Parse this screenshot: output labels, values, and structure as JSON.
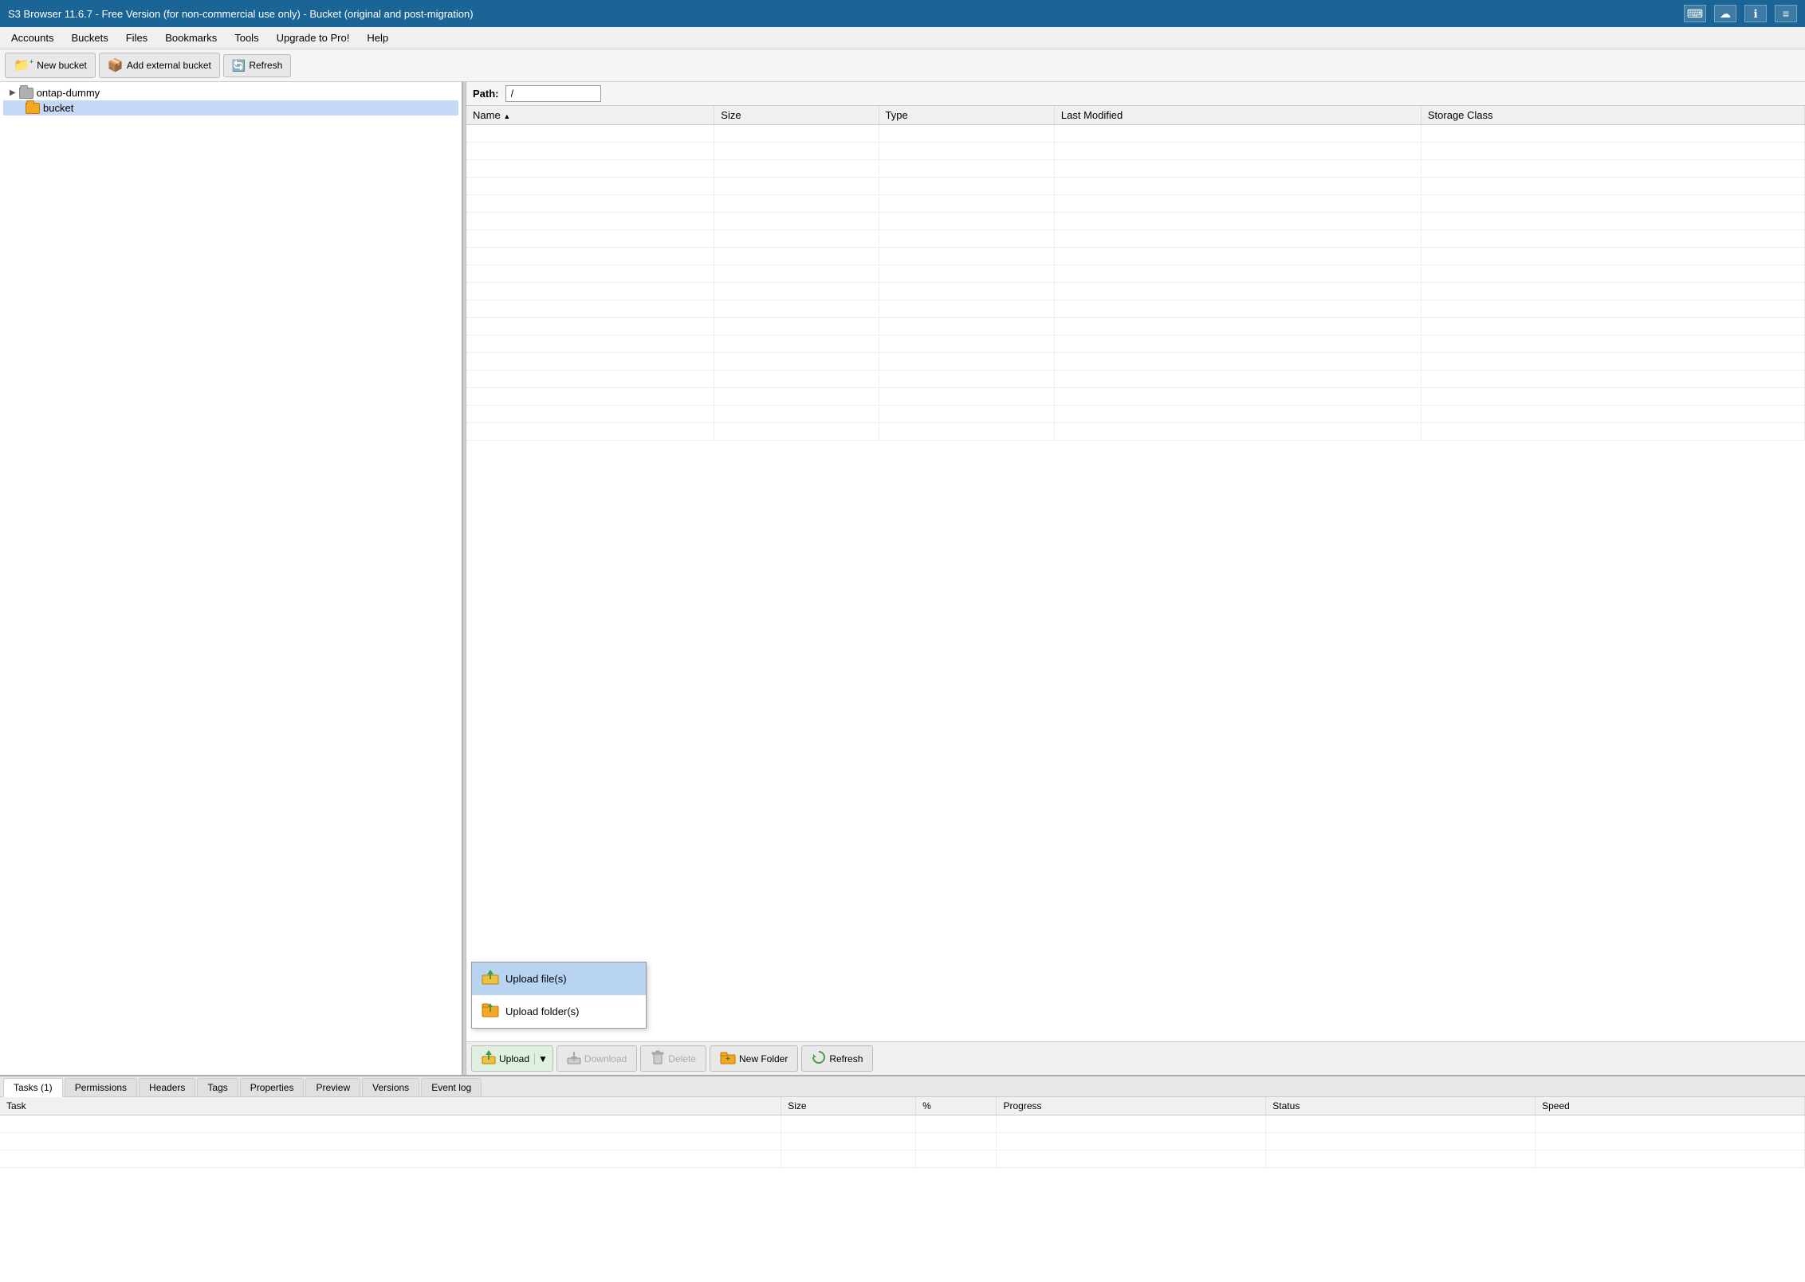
{
  "titleBar": {
    "title": "S3 Browser 11.6.7 - Free Version (for non-commercial use only) - Bucket (original and post-migration)",
    "icons": [
      "keyboard-icon",
      "cloud-icon",
      "info-icon",
      "list-icon"
    ]
  },
  "menuBar": {
    "items": [
      "Accounts",
      "Buckets",
      "Files",
      "Bookmarks",
      "Tools",
      "Upgrade to Pro!",
      "Help"
    ]
  },
  "toolbar": {
    "newBucketLabel": "New bucket",
    "addExternalLabel": "Add external bucket",
    "refreshLabel": "Refresh"
  },
  "pathBar": {
    "label": "Path:",
    "value": "/"
  },
  "fileTable": {
    "columns": [
      "Name",
      "Size",
      "Type",
      "Last Modified",
      "Storage Class"
    ],
    "rows": []
  },
  "bottomToolbar": {
    "uploadLabel": "Upload",
    "downloadLabel": "Download",
    "deleteLabel": "Delete",
    "newFolderLabel": "New Folder",
    "refreshLabel": "Refresh"
  },
  "uploadDropdown": {
    "items": [
      {
        "label": "Upload file(s)",
        "icon": "upload-file-icon"
      },
      {
        "label": "Upload folder(s)",
        "icon": "upload-folder-icon"
      }
    ]
  },
  "treeView": {
    "items": [
      {
        "label": "ontap-dummy",
        "type": "folder-gray",
        "indent": 0
      },
      {
        "label": "bucket",
        "type": "folder-orange",
        "indent": 1,
        "selected": true
      }
    ]
  },
  "tabBar": {
    "tabs": [
      "Tasks (1)",
      "Permissions",
      "Headers",
      "Tags",
      "Properties",
      "Preview",
      "Versions",
      "Event log"
    ],
    "activeTab": "Tasks (1)"
  },
  "tasksTable": {
    "columns": [
      "Task",
      "Size",
      "%",
      "Progress",
      "Status",
      "Speed"
    ],
    "rows": []
  }
}
